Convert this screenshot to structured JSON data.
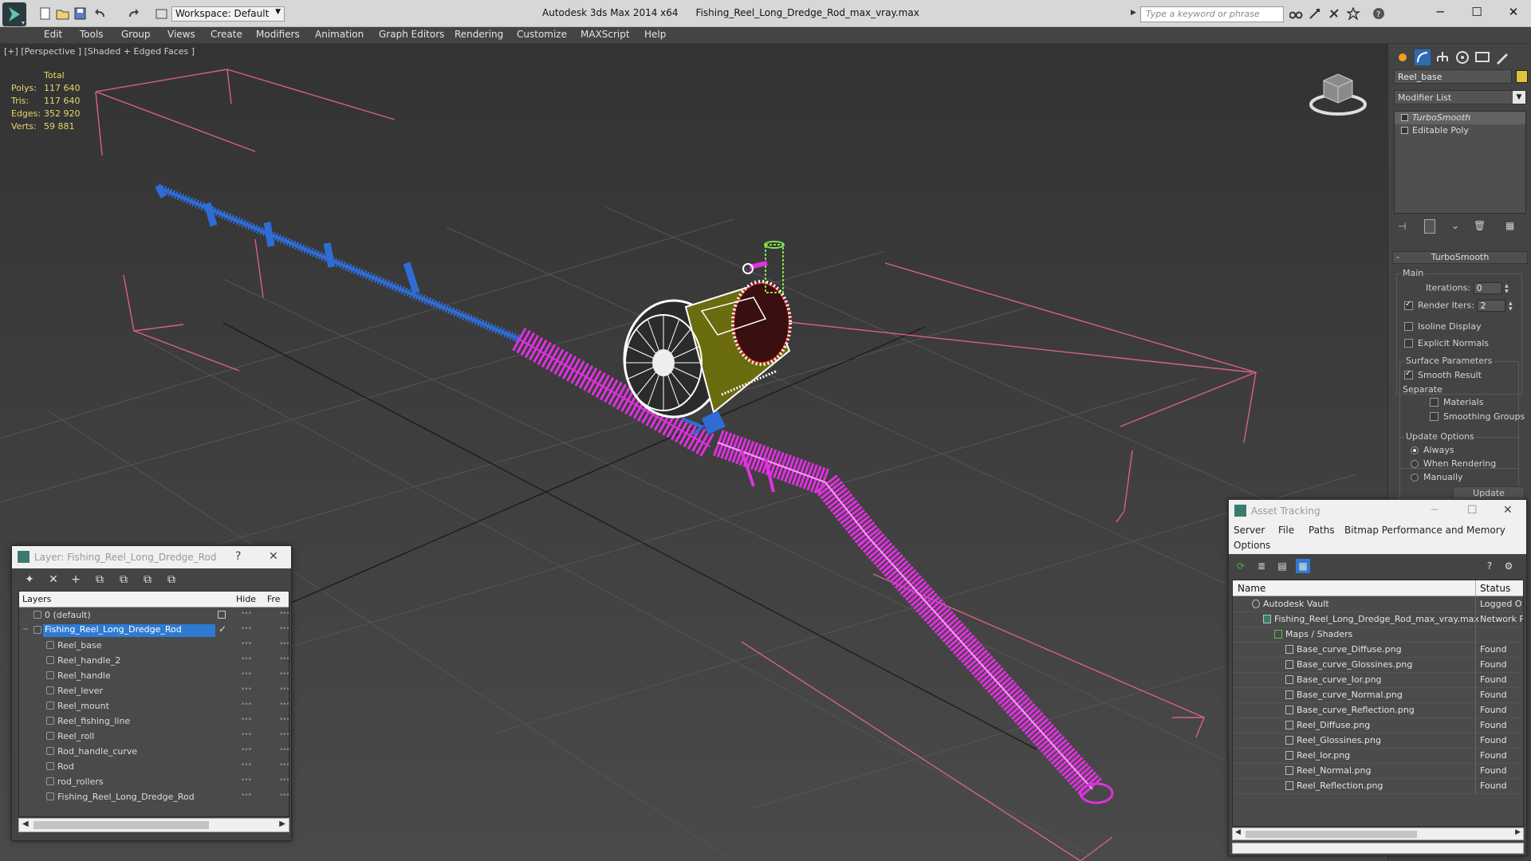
{
  "window": {
    "app_title": "Autodesk 3ds Max  2014 x64",
    "file_title": "Fishing_Reel_Long_Dredge_Rod_max_vray.max",
    "workspace": "Workspace: Default",
    "search_placeholder": "Type a keyword or phrase"
  },
  "menu": [
    "Edit",
    "Tools",
    "Group",
    "Views",
    "Create",
    "Modifiers",
    "Animation",
    "Graph Editors",
    "Rendering",
    "Customize",
    "MAXScript",
    "Help"
  ],
  "viewport": {
    "label": "[+] [Perspective ] [Shaded + Edged Faces ]",
    "stats": {
      "header": "Total",
      "rows": [
        {
          "label": "Polys:",
          "value": "117 640"
        },
        {
          "label": "Tris:",
          "value": "117 640"
        },
        {
          "label": "Edges:",
          "value": "352 920"
        },
        {
          "label": "Verts:",
          "value": "59 881"
        }
      ]
    }
  },
  "command_panel": {
    "object_name": "Reel_base",
    "object_color": "#e0c23a",
    "modifier_list": "Modifier List",
    "stack": [
      {
        "label": "TurboSmooth",
        "active": true
      },
      {
        "label": "Editable Poly",
        "active": false
      }
    ],
    "rollout_title": "TurboSmooth",
    "main_group": "Main",
    "iterations_label": "Iterations:",
    "iterations_value": "0",
    "render_iters_label": "Render Iters:",
    "render_iters_value": "2",
    "isoline_display": "Isoline Display",
    "explicit_normals": "Explicit Normals",
    "surface_params": "Surface Parameters",
    "smooth_result": "Smooth Result",
    "separate": "Separate",
    "materials": "Materials",
    "smoothing_groups": "Smoothing Groups",
    "update_options": "Update Options",
    "always": "Always",
    "when_rendering": "When Rendering",
    "manually": "Manually",
    "update_button": "Update"
  },
  "layer_dialog": {
    "title": "Layer: Fishing_Reel_Long_Dredge_Rod",
    "col_layers": "Layers",
    "col_hide": "Hide",
    "col_freeze": "Fre",
    "rows": [
      {
        "name": "0 (default)",
        "level": 0,
        "selected": false
      },
      {
        "name": "Fishing_Reel_Long_Dredge_Rod",
        "level": 0,
        "selected": true
      },
      {
        "name": "Reel_base",
        "level": 1,
        "selected": false
      },
      {
        "name": "Reel_handle_2",
        "level": 1,
        "selected": false
      },
      {
        "name": "Reel_handle",
        "level": 1,
        "selected": false
      },
      {
        "name": "Reel_lever",
        "level": 1,
        "selected": false
      },
      {
        "name": "Reel_mount",
        "level": 1,
        "selected": false
      },
      {
        "name": "Reel_fishing_line",
        "level": 1,
        "selected": false
      },
      {
        "name": "Reel_roll",
        "level": 1,
        "selected": false
      },
      {
        "name": "Rod_handle_curve",
        "level": 1,
        "selected": false
      },
      {
        "name": "Rod",
        "level": 1,
        "selected": false
      },
      {
        "name": "rod_rollers",
        "level": 1,
        "selected": false
      },
      {
        "name": "Fishing_Reel_Long_Dredge_Rod",
        "level": 1,
        "selected": false
      }
    ]
  },
  "asset_dialog": {
    "title": "Asset Tracking",
    "menu": [
      "Server",
      "File",
      "Paths",
      "Bitmap Performance and Memory",
      "Options"
    ],
    "col_name": "Name",
    "col_status": "Status",
    "rows": [
      {
        "name": "Autodesk Vault",
        "status": "Logged O",
        "level": 0
      },
      {
        "name": "Fishing_Reel_Long_Dredge_Rod_max_vray.max",
        "status": "Network P",
        "level": 1
      },
      {
        "name": "Maps / Shaders",
        "status": "",
        "level": 2
      },
      {
        "name": "Base_curve_Diffuse.png",
        "status": "Found",
        "level": 3
      },
      {
        "name": "Base_curve_Glossines.png",
        "status": "Found",
        "level": 3
      },
      {
        "name": "Base_curve_Ior.png",
        "status": "Found",
        "level": 3
      },
      {
        "name": "Base_curve_Normal.png",
        "status": "Found",
        "level": 3
      },
      {
        "name": "Base_curve_Reflection.png",
        "status": "Found",
        "level": 3
      },
      {
        "name": "Reel_Diffuse.png",
        "status": "Found",
        "level": 3
      },
      {
        "name": "Reel_Glossines.png",
        "status": "Found",
        "level": 3
      },
      {
        "name": "Reel_Ior.png",
        "status": "Found",
        "level": 3
      },
      {
        "name": "Reel_Normal.png",
        "status": "Found",
        "level": 3
      },
      {
        "name": "Reel_Reflection.png",
        "status": "Found",
        "level": 3
      }
    ]
  },
  "colors": {
    "rod_magenta": "#e030e0",
    "tip_blue": "#2f6cd6",
    "bbox_pink": "#d8608c",
    "reel_white": "#ffffff",
    "lever_green": "#7fe04a",
    "selection_blue": "#2f7ad1",
    "stats_yellow": "#e7d76a"
  }
}
